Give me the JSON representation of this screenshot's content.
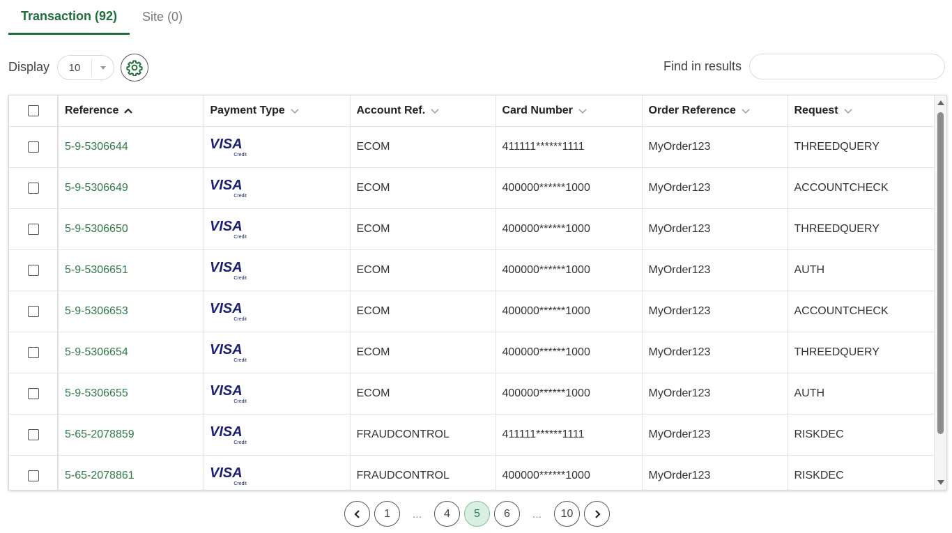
{
  "tabs": [
    {
      "label": "Transaction (92)",
      "active": true
    },
    {
      "label": "Site (0)",
      "active": false
    }
  ],
  "toolbar": {
    "display_label": "Display",
    "display_value": "10",
    "find_label": "Find in results",
    "find_value": ""
  },
  "table": {
    "columns": [
      "Reference",
      "Payment Type",
      "Account Ref.",
      "Card Number",
      "Order Reference",
      "Request"
    ],
    "sorted_column": "Reference",
    "sort_direction": "ascending",
    "rows": [
      {
        "reference": "5-9-5306644",
        "payment_type": "VISA",
        "payment_subtype": "Credit",
        "account_ref": "ECOM",
        "card_number": "411111******1111",
        "order_reference": "MyOrder123",
        "request": "THREEDQUERY"
      },
      {
        "reference": "5-9-5306649",
        "payment_type": "VISA",
        "payment_subtype": "Credit",
        "account_ref": "ECOM",
        "card_number": "400000******1000",
        "order_reference": "MyOrder123",
        "request": "ACCOUNTCHECK"
      },
      {
        "reference": "5-9-5306650",
        "payment_type": "VISA",
        "payment_subtype": "Credit",
        "account_ref": "ECOM",
        "card_number": "400000******1000",
        "order_reference": "MyOrder123",
        "request": "THREEDQUERY"
      },
      {
        "reference": "5-9-5306651",
        "payment_type": "VISA",
        "payment_subtype": "Credit",
        "account_ref": "ECOM",
        "card_number": "400000******1000",
        "order_reference": "MyOrder123",
        "request": "AUTH"
      },
      {
        "reference": "5-9-5306653",
        "payment_type": "VISA",
        "payment_subtype": "Credit",
        "account_ref": "ECOM",
        "card_number": "400000******1000",
        "order_reference": "MyOrder123",
        "request": "ACCOUNTCHECK"
      },
      {
        "reference": "5-9-5306654",
        "payment_type": "VISA",
        "payment_subtype": "Credit",
        "account_ref": "ECOM",
        "card_number": "400000******1000",
        "order_reference": "MyOrder123",
        "request": "THREEDQUERY"
      },
      {
        "reference": "5-9-5306655",
        "payment_type": "VISA",
        "payment_subtype": "Credit",
        "account_ref": "ECOM",
        "card_number": "400000******1000",
        "order_reference": "MyOrder123",
        "request": "AUTH"
      },
      {
        "reference": "5-65-2078859",
        "payment_type": "VISA",
        "payment_subtype": "Credit",
        "account_ref": "FRAUDCONTROL",
        "card_number": "411111******1111",
        "order_reference": "MyOrder123",
        "request": "RISKDEC"
      },
      {
        "reference": "5-65-2078861",
        "payment_type": "VISA",
        "payment_subtype": "Credit",
        "account_ref": "FRAUDCONTROL",
        "card_number": "400000******1000",
        "order_reference": "MyOrder123",
        "request": "RISKDEC"
      }
    ]
  },
  "pagination": {
    "items": [
      "prev",
      "1",
      "…",
      "4",
      "5",
      "6",
      "…",
      "10",
      "next"
    ],
    "current": "5"
  },
  "colors": {
    "accent": "#1f6f3c",
    "link": "#2e7a46",
    "visa_blue": "#1a1f71",
    "active_page_bg": "#d9efe1"
  },
  "icons": {
    "settings": "gear-icon",
    "sort_asc": "chevron-up-icon",
    "sort_none": "chevron-down-icon",
    "prev": "chevron-left-icon",
    "next": "chevron-right-icon"
  }
}
